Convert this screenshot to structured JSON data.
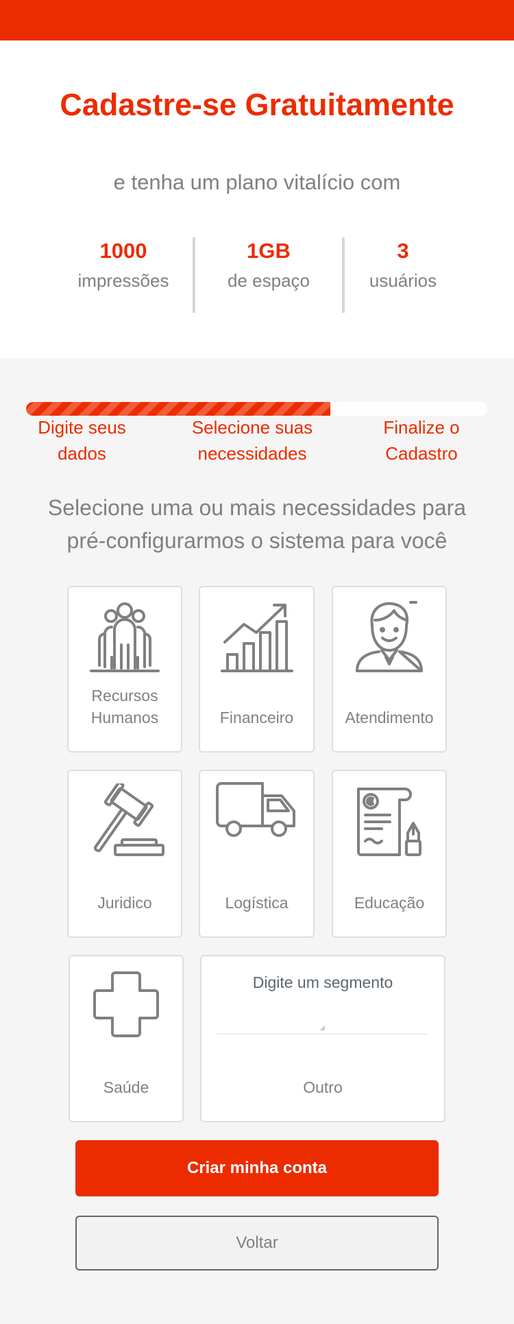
{
  "hero": {
    "title": "Cadastre-se Gratuitamente",
    "subtitle": "e tenha um plano vitalício com"
  },
  "stats": [
    {
      "value": "1000",
      "label": "impressões"
    },
    {
      "value": "1GB",
      "label": "de espaço"
    },
    {
      "value": "3",
      "label": "usuários"
    }
  ],
  "progress": {
    "fraction": 0.66,
    "steps": [
      {
        "line1": "Digite seus",
        "line2": "dados"
      },
      {
        "line1": "Selecione suas",
        "line2": "necessidades"
      },
      {
        "line1": "Finalize o",
        "line2": "Cadastro"
      }
    ]
  },
  "instructions": {
    "line1": "Selecione uma ou mais necessidades para",
    "line2": "pré-configurarmos o sistema para você"
  },
  "options": [
    {
      "line1": "Recursos",
      "line2": "Humanos",
      "icon": "people-icon"
    },
    {
      "label": "Financeiro",
      "icon": "growth-chart-icon"
    },
    {
      "label": "Atendimento",
      "icon": "support-agent-icon"
    },
    {
      "label": "Juridico",
      "icon": "gavel-icon"
    },
    {
      "label": "Logística",
      "icon": "truck-icon"
    },
    {
      "label": "Educação",
      "icon": "diploma-icon"
    },
    {
      "label": "Saúde",
      "icon": "medical-cross-icon"
    }
  ],
  "other_segment": {
    "prompt": "Digite um segmento",
    "label": "Outro",
    "value": ""
  },
  "actions": {
    "primary": "Criar minha conta",
    "secondary": "Voltar"
  },
  "colors": {
    "brand": "#ec2c00",
    "text_muted": "#808080",
    "background": "#f5f5f5"
  }
}
